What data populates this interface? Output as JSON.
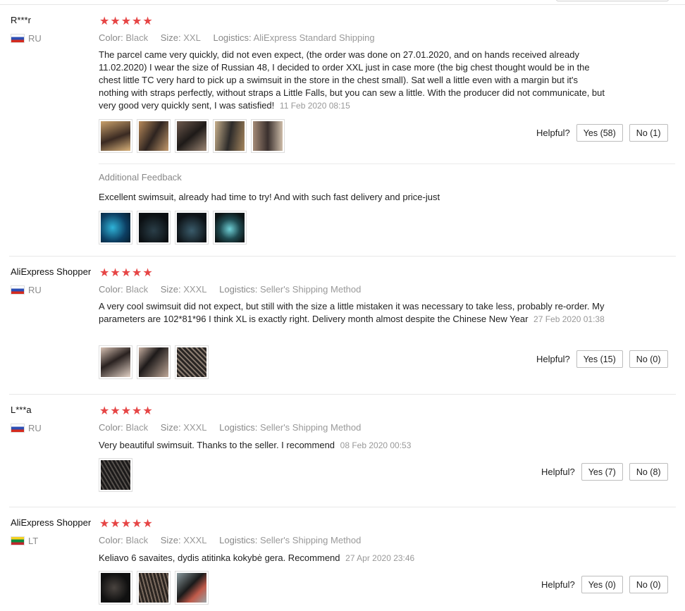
{
  "reviews": [
    {
      "user": "R***r",
      "country": "RU",
      "stars": "★★★★★",
      "color_label": "Color:",
      "color": "Black",
      "size_label": "Size:",
      "size": "XXL",
      "logistics_label": "Logistics:",
      "logistics": "AliExpress Standard Shipping",
      "text": "The parcel came very quickly, did not even expect, (the order was done on 27.01.2020, and on hands received already 11.02.2020) I wear the size of Russian 48, I decided to order XXL just in case more (the big chest thought would be in the chest little TC very hard to pick up a swimsuit in the store in the chest small). Sat well a little even with a margin but it's nothing with straps perfectly, without straps a Little Falls, but you can sew a little. With the producer did not communicate, but very good very quickly sent, I was satisfied!",
      "date": "11 Feb 2020 08:15",
      "helpful_label": "Helpful?",
      "yes": "Yes (58)",
      "no": "No (1)",
      "additional_title": "Additional Feedback",
      "additional_text": "Excellent swimsuit, already had time to try! And with such fast delivery and price-just"
    },
    {
      "user": "AliExpress Shopper",
      "country": "RU",
      "stars": "★★★★★",
      "color_label": "Color:",
      "color": "Black",
      "size_label": "Size:",
      "size": "XXXL",
      "logistics_label": "Logistics:",
      "logistics": "Seller's Shipping Method",
      "text": "A very cool swimsuit did not expect, but still with the size a little mistaken it was necessary to take less, probably re-order. My parameters are 102*81*96 I think XL is exactly right. Delivery month almost despite the Chinese New Year",
      "date": "27 Feb 2020 01:38",
      "helpful_label": "Helpful?",
      "yes": "Yes (15)",
      "no": "No (0)"
    },
    {
      "user": "L***a",
      "country": "RU",
      "stars": "★★★★★",
      "color_label": "Color:",
      "color": "Black",
      "size_label": "Size:",
      "size": "XXXL",
      "logistics_label": "Logistics:",
      "logistics": "Seller's Shipping Method",
      "text": "Very beautiful swimsuit. Thanks to the seller. I recommend",
      "date": "08 Feb 2020 00:53",
      "helpful_label": "Helpful?",
      "yes": "Yes (7)",
      "no": "No (8)"
    },
    {
      "user": "AliExpress Shopper",
      "country": "LT",
      "stars": "★★★★★",
      "color_label": "Color:",
      "color": "Black",
      "size_label": "Size:",
      "size": "XXXL",
      "logistics_label": "Logistics:",
      "logistics": "Seller's Shipping Method",
      "text": "Keliavo 6 savaites, dydis atitinka kokybė gera. Recommend",
      "date": "27 Apr 2020 23:46",
      "helpful_label": "Helpful?",
      "yes": "Yes (0)",
      "no": "No (0)"
    }
  ],
  "colors": {
    "star": "#e64545",
    "muted": "#999999",
    "border": "#bdbdbd"
  }
}
